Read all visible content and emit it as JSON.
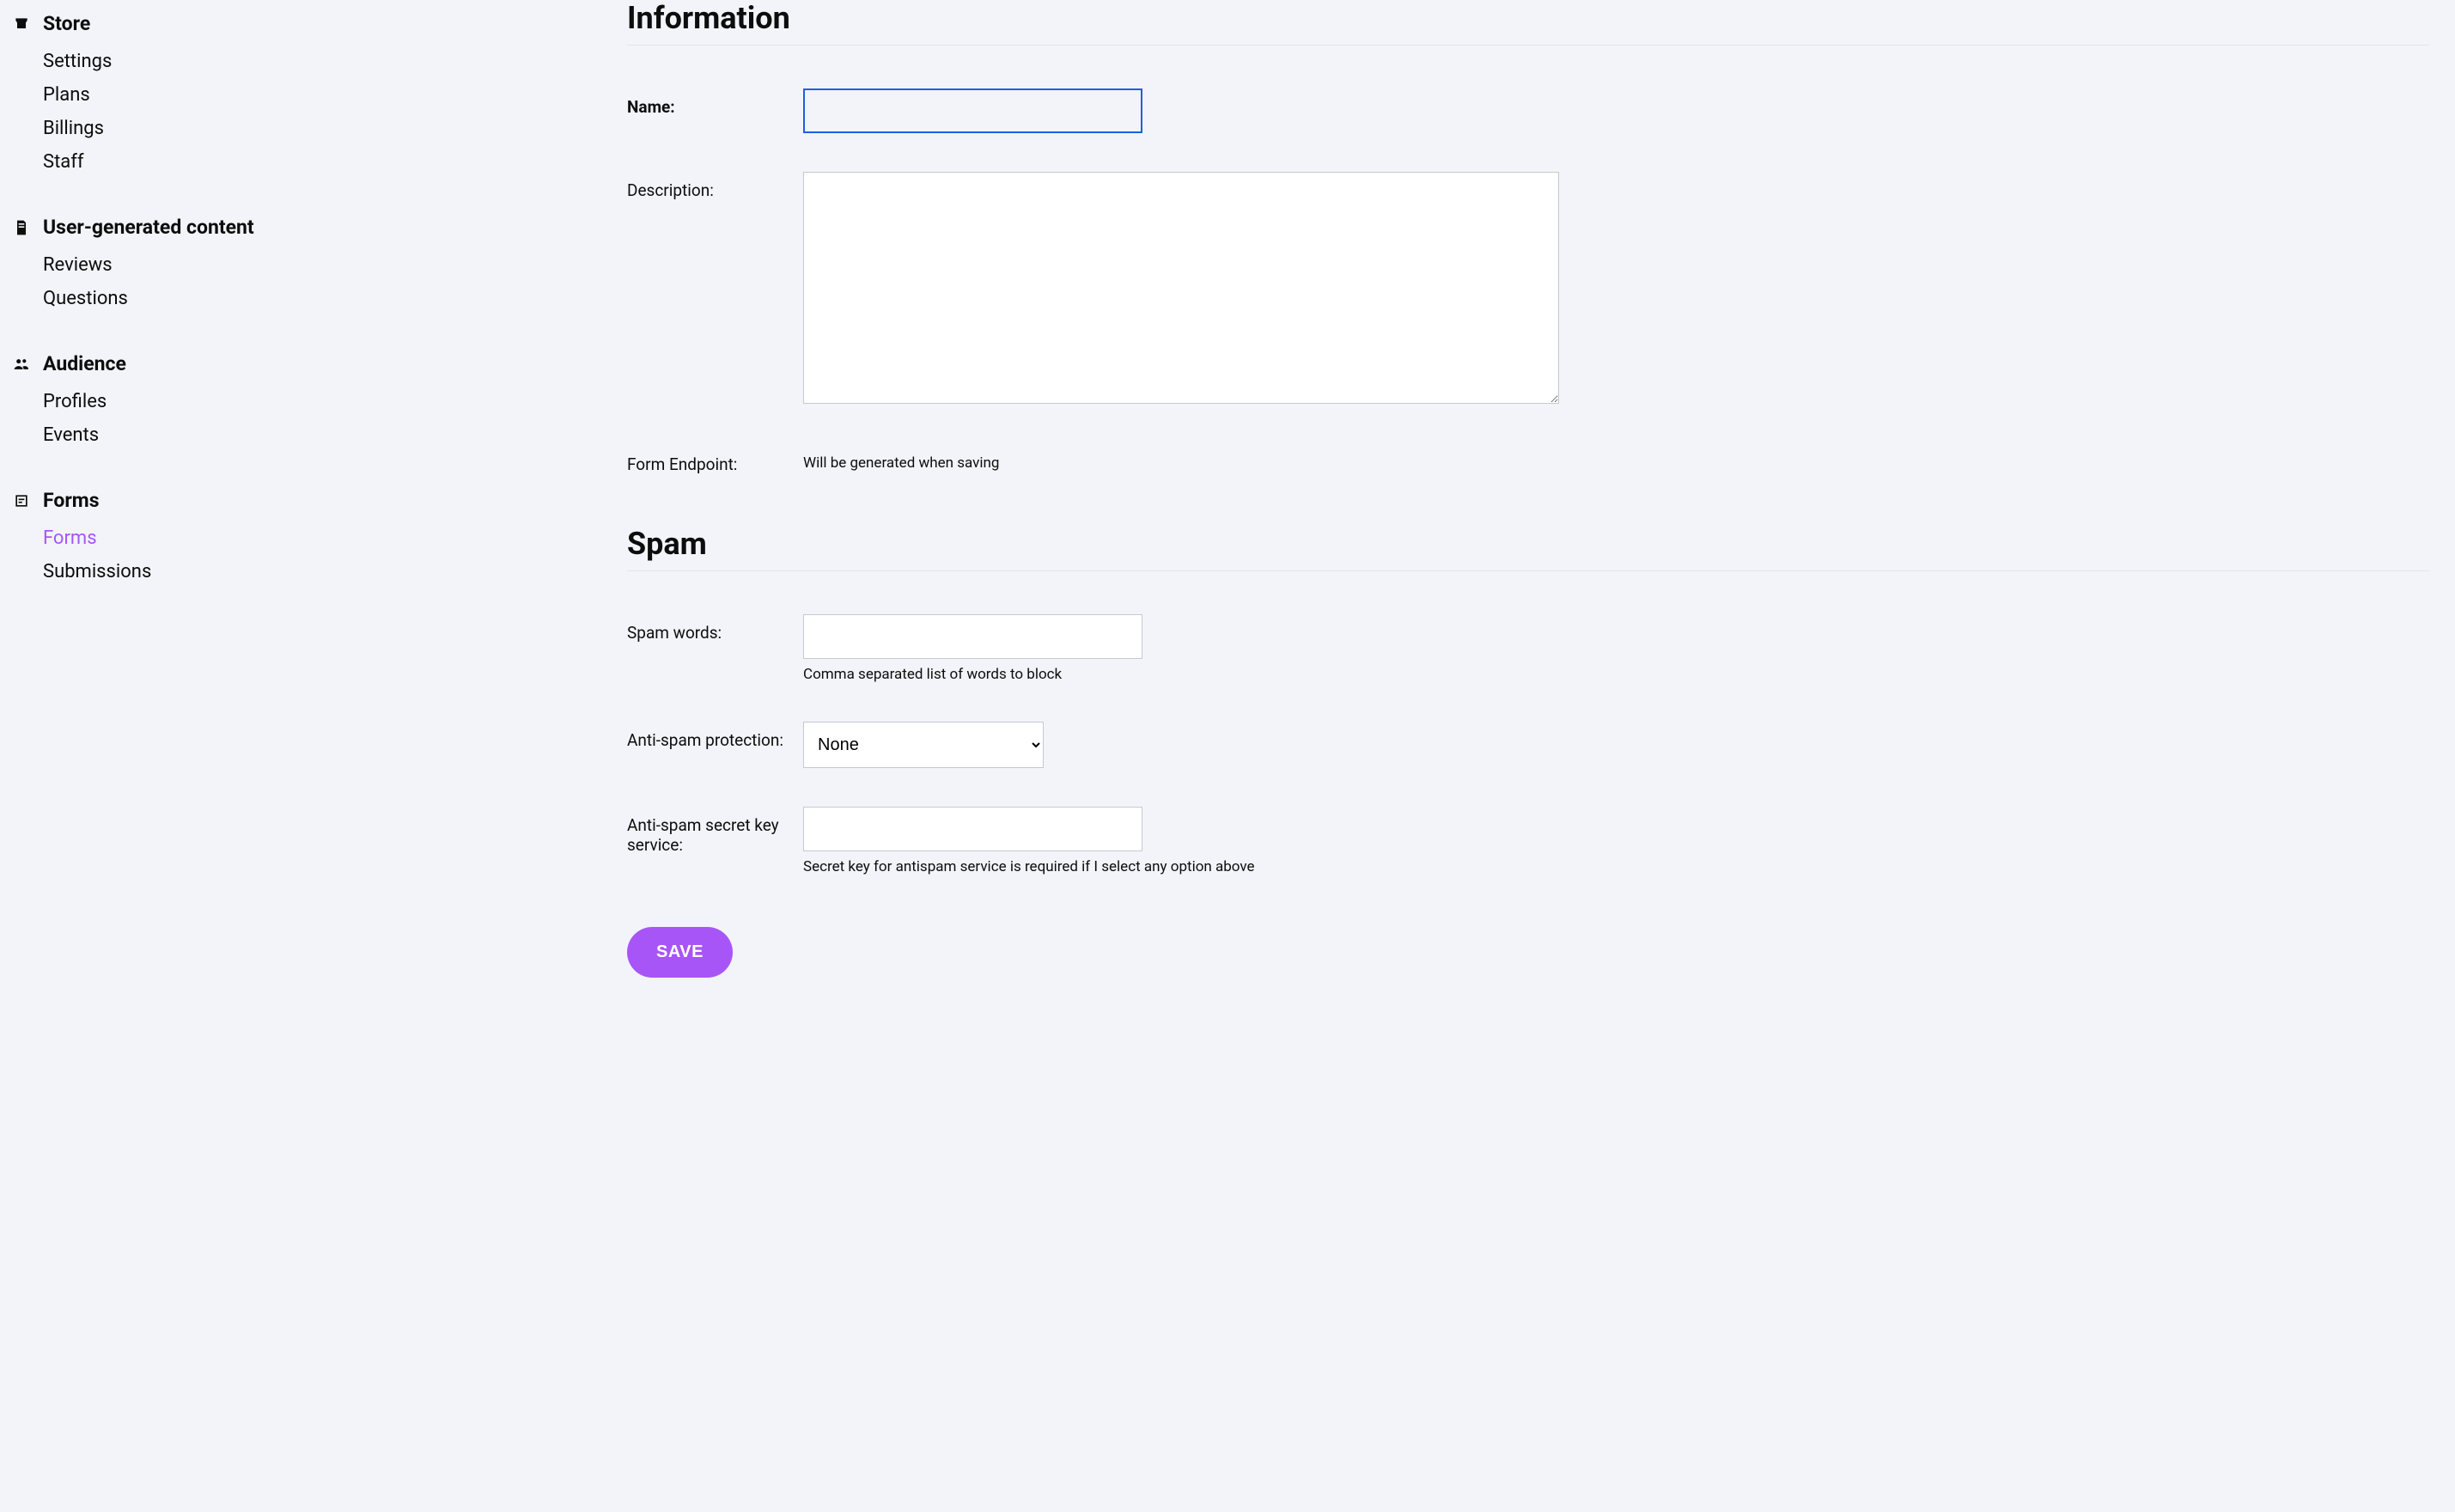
{
  "sidebar": {
    "groups": [
      {
        "icon": "store-icon",
        "title": "Store",
        "items": [
          {
            "label": "Settings",
            "active": false
          },
          {
            "label": "Plans",
            "active": false
          },
          {
            "label": "Billings",
            "active": false
          },
          {
            "label": "Staff",
            "active": false
          }
        ]
      },
      {
        "icon": "document-icon",
        "title": "User-generated content",
        "items": [
          {
            "label": "Reviews",
            "active": false
          },
          {
            "label": "Questions",
            "active": false
          }
        ]
      },
      {
        "icon": "people-icon",
        "title": "Audience",
        "items": [
          {
            "label": "Profiles",
            "active": false
          },
          {
            "label": "Events",
            "active": false
          }
        ]
      },
      {
        "icon": "forms-icon",
        "title": "Forms",
        "items": [
          {
            "label": "Forms",
            "active": true
          },
          {
            "label": "Submissions",
            "active": false
          }
        ]
      }
    ]
  },
  "sections": {
    "information": {
      "heading": "Information",
      "fields": {
        "name": {
          "label": "Name:",
          "value": ""
        },
        "description": {
          "label": "Description:",
          "value": ""
        },
        "endpoint": {
          "label": "Form Endpoint:",
          "text": "Will be generated when saving"
        }
      }
    },
    "spam": {
      "heading": "Spam",
      "fields": {
        "words": {
          "label": "Spam words:",
          "value": "",
          "help": "Comma separated list of words to block"
        },
        "protection": {
          "label": "Anti-spam protection:",
          "value": "None"
        },
        "secret": {
          "label": "Anti-spam secret key service:",
          "value": "",
          "help": "Secret key for antispam service is required if I select any option above"
        }
      }
    }
  },
  "actions": {
    "save": "SAVE"
  }
}
